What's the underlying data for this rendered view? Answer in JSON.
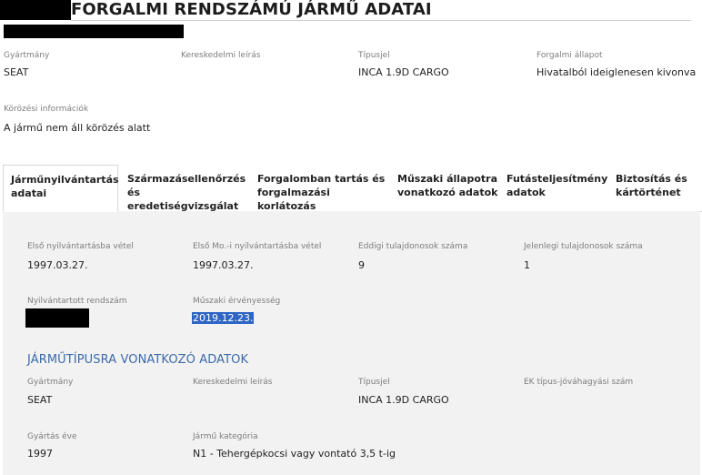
{
  "header": {
    "title": "FORGALMI RENDSZÁMÚ JÁRMŰ ADATAI"
  },
  "summary": {
    "fields": [
      {
        "label": "Gyártmány",
        "value": "SEAT"
      },
      {
        "label": "Kereskedelmi leírás",
        "value": ""
      },
      {
        "label": "Típusjel",
        "value": "INCA 1.9D CARGO"
      },
      {
        "label": "Forgalmi állapot",
        "value": "Hivatalból ideiglenesen kivonva"
      }
    ],
    "wanted": {
      "label": "Körözési információk",
      "value": "A jármű nem áll körözés alatt"
    }
  },
  "tabs": [
    {
      "label": "Járműnyilvántartás adatai",
      "active": true
    },
    {
      "label": "Származásellenőrzés és eredetiségvizsgálat",
      "active": false
    },
    {
      "label": "Forgalomban tartás és forgalmazási korlátozás",
      "active": false
    },
    {
      "label": "Műszaki állapotra vonatkozó adatok",
      "active": false
    },
    {
      "label": "Futásteljesítmény adatok",
      "active": false
    },
    {
      "label": "Biztosítás és kártörténet",
      "active": false
    }
  ],
  "registry": {
    "first_reg": {
      "label": "Első nyilvántartásba vétel",
      "value": "1997.03.27."
    },
    "first_hu_reg": {
      "label": "Első Mo.-i nyilvántartásba vétel",
      "value": "1997.03.27."
    },
    "prev_owners": {
      "label": "Eddigi tulajdonosok száma",
      "value": "9"
    },
    "current_owners": {
      "label": "Jelenlegi tulajdonosok száma",
      "value": "1"
    },
    "plate": {
      "label": "Nyilvántartott rendszám",
      "value": ""
    },
    "tech_validity": {
      "label": "Műszaki érvényesség",
      "value": "2019.12.23."
    }
  },
  "type_data": {
    "title": "JÁRMŰTÍPUSRA VONATKOZÓ ADATOK",
    "make": {
      "label": "Gyártmány",
      "value": "SEAT"
    },
    "commercial": {
      "label": "Kereskedelmi leírás",
      "value": ""
    },
    "type_code": {
      "label": "Típusjel",
      "value": "INCA 1.9D CARGO"
    },
    "ek_approval": {
      "label": "EK típus-jóváhagyási szám",
      "value": ""
    },
    "year": {
      "label": "Gyártás éve",
      "value": "1997"
    },
    "category": {
      "label": "Jármű kategória",
      "value": "N1 - Tehergépkocsi vagy vontató 3,5 t-ig"
    }
  }
}
